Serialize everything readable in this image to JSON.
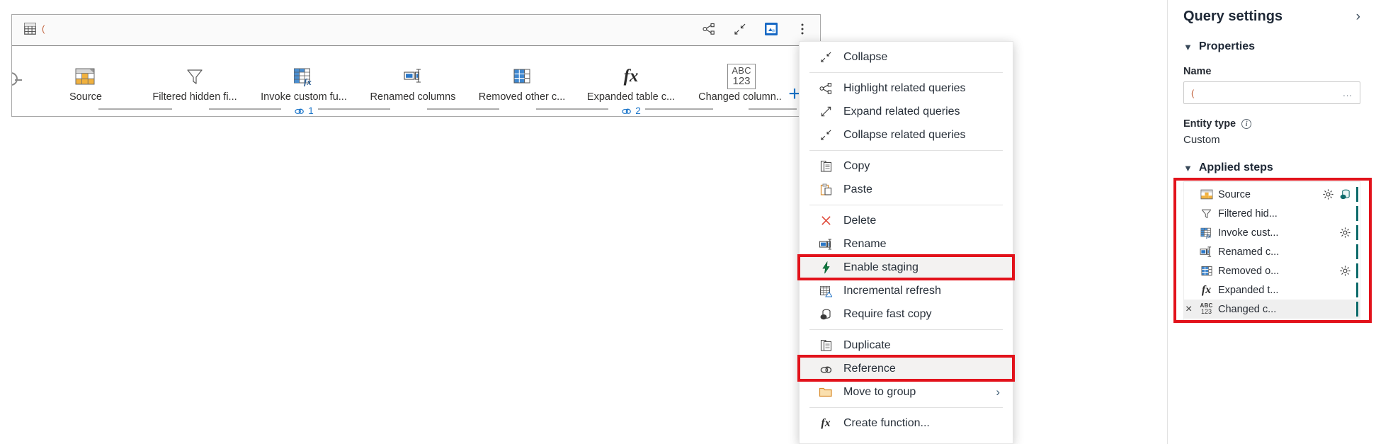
{
  "diagram": {
    "query_title": "(",
    "toolbar": [
      {
        "name": "highlight-related-queries-icon",
        "label": "Highlight related queries"
      },
      {
        "name": "collapse-icon",
        "label": "Collapse"
      },
      {
        "name": "data-source-settings-icon",
        "label": "Data source settings"
      },
      {
        "name": "more-options-icon",
        "label": "More options"
      }
    ],
    "add_step_label": "+",
    "steps": [
      {
        "label": "Source",
        "icon": "table-source-icon",
        "refs": ""
      },
      {
        "label": "Filtered hidden fi...",
        "icon": "filter-icon",
        "refs": ""
      },
      {
        "label": "Invoke custom fu...",
        "icon": "invoke-function-icon",
        "refs": "1"
      },
      {
        "label": "Renamed columns",
        "icon": "rename-columns-icon",
        "refs": ""
      },
      {
        "label": "Removed other c...",
        "icon": "remove-columns-icon",
        "refs": ""
      },
      {
        "label": "Expanded table c...",
        "icon": "fx-icon",
        "refs": "2"
      },
      {
        "label": "Changed column...",
        "icon": "abc123-icon",
        "refs": ""
      }
    ]
  },
  "context_menu": {
    "items": [
      {
        "label": "Collapse",
        "icon": "collapse-icon",
        "sep_after": true
      },
      {
        "label": "Highlight related queries",
        "icon": "highlight-related-queries-icon"
      },
      {
        "label": "Expand related queries",
        "icon": "expand-related-queries-icon"
      },
      {
        "label": "Collapse related queries",
        "icon": "collapse-related-queries-icon",
        "sep_after": true
      },
      {
        "label": "Copy",
        "icon": "copy-icon"
      },
      {
        "label": "Paste",
        "icon": "paste-icon",
        "sep_after": true
      },
      {
        "label": "Delete",
        "icon": "delete-x-icon"
      },
      {
        "label": "Rename",
        "icon": "rename-icon"
      },
      {
        "label": "Enable staging",
        "icon": "lightning-bolt-icon",
        "highlighted": true
      },
      {
        "label": "Incremental refresh",
        "icon": "incremental-refresh-icon"
      },
      {
        "label": "Require fast copy",
        "icon": "fast-copy-icon",
        "sep_after": true
      },
      {
        "label": "Duplicate",
        "icon": "duplicate-icon"
      },
      {
        "label": "Reference",
        "icon": "reference-link-icon",
        "highlighted": true
      },
      {
        "label": "Move to group",
        "icon": "folder-icon",
        "submenu": true,
        "sep_after": true
      },
      {
        "label": "Create function...",
        "icon": "fx-icon"
      }
    ]
  },
  "query_settings": {
    "title": "Query settings",
    "expand_icon": "chevron-right-icon",
    "properties_section": "Properties",
    "name_label": "Name",
    "name_value": "(",
    "name_ellipsis": "...",
    "entity_type_label": "Entity type",
    "entity_type_value": "Custom",
    "applied_steps_section": "Applied steps",
    "steps": [
      {
        "label": "Source",
        "icon": "table-source-icon",
        "gear": true,
        "source_icon": true
      },
      {
        "label": "Filtered hid...",
        "icon": "filter-icon",
        "gear": false
      },
      {
        "label": "Invoke cust...",
        "icon": "invoke-function-icon",
        "gear": true
      },
      {
        "label": "Renamed c...",
        "icon": "rename-columns-icon",
        "gear": false
      },
      {
        "label": "Removed o...",
        "icon": "remove-columns-icon",
        "gear": true
      },
      {
        "label": "Expanded t...",
        "icon": "fx-icon",
        "gear": false
      },
      {
        "label": "Changed c...",
        "icon": "abc123-icon",
        "gear": false,
        "active": true,
        "delete": "×"
      }
    ]
  },
  "colors": {
    "highlight_red": "#e2121b",
    "link_blue": "#1a74c9",
    "accent_teal": "#0f6c6c",
    "orange": "#e8a33d"
  }
}
